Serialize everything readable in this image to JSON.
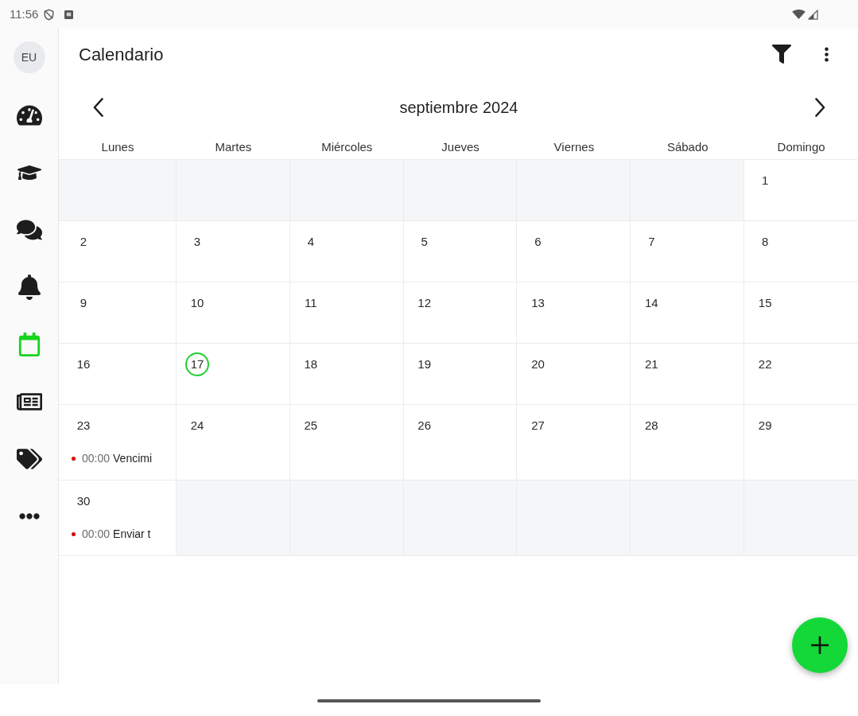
{
  "status_bar": {
    "time": "11:56"
  },
  "sidebar": {
    "avatar": "EU",
    "items": [
      {
        "selected": false
      },
      {
        "selected": false
      },
      {
        "selected": false
      },
      {
        "selected": false
      },
      {
        "selected": true
      },
      {
        "selected": false
      },
      {
        "selected": false
      },
      {
        "selected": false
      }
    ]
  },
  "header": {
    "title": "Calendario"
  },
  "calendar": {
    "month": "septiembre 2024",
    "weekdays": [
      "Lunes",
      "Martes",
      "Miércoles",
      "Jueves",
      "Viernes",
      "Sábado",
      "Domingo"
    ],
    "weeks": [
      [
        {
          "kind": "blank"
        },
        {
          "kind": "blank"
        },
        {
          "kind": "blank"
        },
        {
          "kind": "blank"
        },
        {
          "kind": "blank"
        },
        {
          "kind": "blank"
        },
        {
          "kind": "day",
          "day": "1",
          "today": false
        }
      ],
      [
        {
          "kind": "day",
          "day": "2",
          "today": false
        },
        {
          "kind": "day",
          "day": "3",
          "today": false
        },
        {
          "kind": "day",
          "day": "4",
          "today": false
        },
        {
          "kind": "day",
          "day": "5",
          "today": false
        },
        {
          "kind": "day",
          "day": "6",
          "today": false
        },
        {
          "kind": "day",
          "day": "7",
          "today": false
        },
        {
          "kind": "day",
          "day": "8",
          "today": false
        }
      ],
      [
        {
          "kind": "day",
          "day": "9",
          "today": false
        },
        {
          "kind": "day",
          "day": "10",
          "today": false
        },
        {
          "kind": "day",
          "day": "11",
          "today": false
        },
        {
          "kind": "day",
          "day": "12",
          "today": false
        },
        {
          "kind": "day",
          "day": "13",
          "today": false
        },
        {
          "kind": "day",
          "day": "14",
          "today": false
        },
        {
          "kind": "day",
          "day": "15",
          "today": false
        }
      ],
      [
        {
          "kind": "day",
          "day": "16",
          "today": false
        },
        {
          "kind": "day",
          "day": "17",
          "today": true
        },
        {
          "kind": "day",
          "day": "18",
          "today": false
        },
        {
          "kind": "day",
          "day": "19",
          "today": false
        },
        {
          "kind": "day",
          "day": "20",
          "today": false
        },
        {
          "kind": "day",
          "day": "21",
          "today": false
        },
        {
          "kind": "day",
          "day": "22",
          "today": false
        }
      ],
      [
        {
          "kind": "day",
          "day": "23",
          "today": false,
          "events": [
            {
              "time": "00:00",
              "title": "Vencimi",
              "color": "#d50000"
            }
          ]
        },
        {
          "kind": "day",
          "day": "24",
          "today": false
        },
        {
          "kind": "day",
          "day": "25",
          "today": false
        },
        {
          "kind": "day",
          "day": "26",
          "today": false
        },
        {
          "kind": "day",
          "day": "27",
          "today": false
        },
        {
          "kind": "day",
          "day": "28",
          "today": false
        },
        {
          "kind": "day",
          "day": "29",
          "today": false
        }
      ],
      [
        {
          "kind": "day",
          "day": "30",
          "today": false,
          "events": [
            {
              "time": "00:00",
              "title": "Enviar t",
              "color": "#d50000"
            }
          ]
        },
        {
          "kind": "blank"
        },
        {
          "kind": "blank"
        },
        {
          "kind": "blank"
        },
        {
          "kind": "blank"
        },
        {
          "kind": "blank"
        },
        {
          "kind": "blank"
        }
      ]
    ]
  }
}
